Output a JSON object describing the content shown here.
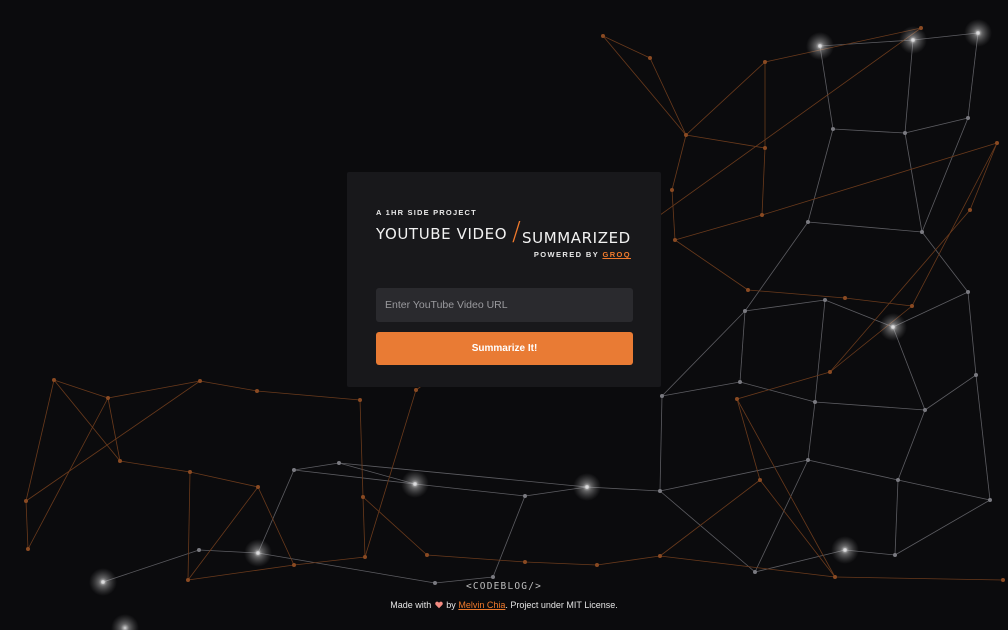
{
  "header": {
    "eyebrow": "A 1HR SIDE PROJECT",
    "title_part1": "YOUTUBE VIDEO",
    "title_separator": "/",
    "title_part2": "SUMMARIZED",
    "powered_prefix": "POWERED BY",
    "powered_link": "GROQ"
  },
  "form": {
    "url_placeholder": "Enter YouTube Video URL",
    "url_value": "",
    "submit_label": "Summarize It!"
  },
  "footer": {
    "logo_text": "<CODEBLOG/>",
    "made_with": "Made with",
    "heart_icon": "heart-icon",
    "by": "by",
    "author": "Melvin Chia",
    "license_text": ". Project under MIT License."
  },
  "colors": {
    "background": "#0b0b0d",
    "card": "#18181b",
    "accent": "#e97b34",
    "input_bg": "#2a2a2e"
  }
}
